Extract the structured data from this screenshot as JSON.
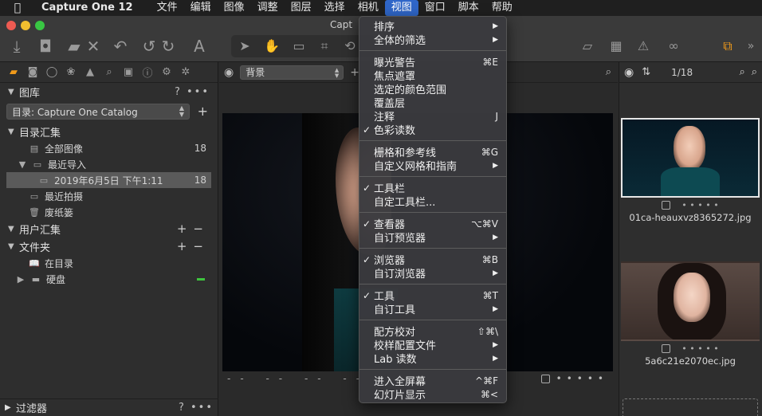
{
  "menubar": {
    "app": "Capture One 12",
    "items": [
      "文件",
      "编辑",
      "图像",
      "调整",
      "图层",
      "选择",
      "相机",
      "视图",
      "窗口",
      "脚本",
      "帮助"
    ],
    "active": "视图"
  },
  "window": {
    "title": "Capt"
  },
  "library": {
    "title": "图库",
    "catalog_select": "目录: Capture One Catalog",
    "catalog_collection": "目录汇集",
    "all_images": "全部图像",
    "all_images_count": "18",
    "recent_imports": "最近导入",
    "import_date": "2019年6月5日 下午1:11",
    "import_count": "18",
    "recent_captures": "最近拍摄",
    "trash": "废纸篓",
    "user_collection": "用户汇集",
    "folders": "文件夹",
    "in_catalog": "在目录",
    "hard_disk": "硬盘",
    "filters": "过滤器",
    "help": "?"
  },
  "viewer": {
    "background_select": "背景",
    "footer": "-- -- -- --"
  },
  "browser": {
    "counter": "1/18",
    "files": [
      "01ca-heauxvz8365272.jpg",
      "5a6c21e2070ec.jpg"
    ]
  },
  "view_menu": {
    "groups": [
      [
        {
          "label": "排序",
          "submenu": true
        },
        {
          "label": "全体的筛选",
          "submenu": true
        }
      ],
      [
        {
          "label": "曝光警告",
          "shortcut": "⌘E"
        },
        {
          "label": "焦点遮罩"
        },
        {
          "label": "选定的颜色范围"
        },
        {
          "label": "覆盖层"
        },
        {
          "label": "注释",
          "shortcut": "J"
        },
        {
          "label": "色彩读数",
          "checked": true
        }
      ],
      [
        {
          "label": "栅格和参考线",
          "shortcut": "⌘G"
        },
        {
          "label": "自定义网格和指南",
          "submenu": true
        }
      ],
      [
        {
          "label": "工具栏",
          "checked": true
        },
        {
          "label": "自定工具栏..."
        }
      ],
      [
        {
          "label": "查看器",
          "checked": true,
          "shortcut": "⌥⌘V"
        },
        {
          "label": "自订预览器",
          "submenu": true
        }
      ],
      [
        {
          "label": "浏览器",
          "checked": true,
          "shortcut": "⌘B"
        },
        {
          "label": "自订浏览器",
          "submenu": true
        }
      ],
      [
        {
          "label": "工具",
          "checked": true,
          "shortcut": "⌘T"
        },
        {
          "label": "自订工具",
          "submenu": true
        }
      ],
      [
        {
          "label": "配方校对",
          "shortcut": "⇧⌘\\"
        },
        {
          "label": "校样配置文件",
          "submenu": true
        },
        {
          "label": "Lab 读数",
          "submenu": true
        }
      ],
      [
        {
          "label": "进入全屏幕",
          "shortcut": "^⌘F"
        },
        {
          "label": "幻灯片显示",
          "shortcut": "⌘<"
        }
      ]
    ]
  },
  "colors": {
    "accent": "#2f66c8",
    "orange": "#f09a1a",
    "green": "#3ec43e"
  }
}
